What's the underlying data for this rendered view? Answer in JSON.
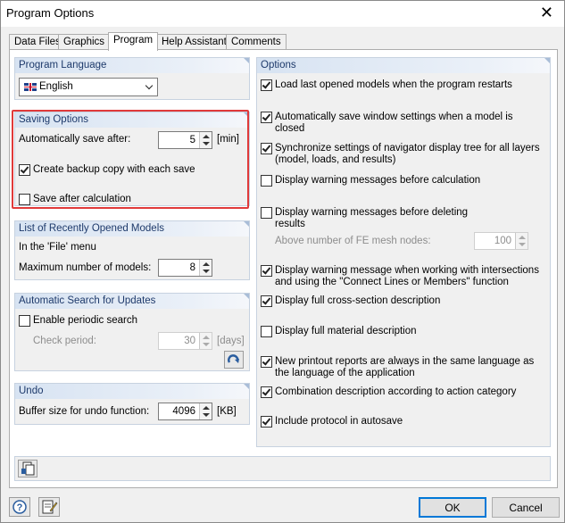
{
  "window": {
    "title": "Program Options",
    "close_glyph": "✕"
  },
  "tabs": [
    {
      "label": "Data Files",
      "active": false
    },
    {
      "label": "Graphics",
      "active": false
    },
    {
      "label": "Program",
      "active": true
    },
    {
      "label": "Help Assistant",
      "active": false
    },
    {
      "label": "Comments",
      "active": false
    }
  ],
  "program_language": {
    "title": "Program Language",
    "selected": "English",
    "flag_icon": "uk-flag-icon"
  },
  "saving_options": {
    "title": "Saving Options",
    "autosave_label": "Automatically save after:",
    "autosave_value": "5",
    "autosave_unit": "[min]",
    "backup_label": "Create backup copy with each save",
    "backup_checked": true,
    "save_after_calc_label": "Save after calculation",
    "save_after_calc_checked": false
  },
  "recent_models": {
    "title": "List of Recently Opened Models",
    "in_file_menu": "In the 'File' menu",
    "max_label": "Maximum number of models:",
    "max_value": "8"
  },
  "auto_update": {
    "title": "Automatic Search for Updates",
    "periodic_label": "Enable periodic search",
    "periodic_checked": false,
    "check_period_label": "Check period:",
    "check_period_value": "30",
    "check_period_unit": "[days]",
    "refresh_icon": "refresh-icon"
  },
  "undo": {
    "title": "Undo",
    "buffer_label": "Buffer size for undo function:",
    "buffer_value": "4096",
    "buffer_unit": "[KB]"
  },
  "options": {
    "title": "Options",
    "items": [
      {
        "line1": "Load last opened models when the program restarts",
        "line2": "",
        "checked": true
      },
      {
        "line1": "Automatically save window settings when a model is",
        "line2": "closed",
        "checked": true
      },
      {
        "line1": "Synchronize settings of navigator display tree for all layers",
        "line2": "(model, loads, and results)",
        "checked": true
      },
      {
        "line1": "Display warning messages before calculation",
        "line2": "",
        "checked": false
      },
      {
        "line1": "Display warning messages before deleting",
        "line2": "results",
        "checked": false
      },
      {
        "line1": "Display warning message when working with intersections",
        "line2": "and using the \"Connect Lines or Members\" function",
        "checked": true
      },
      {
        "line1": "Display full cross-section description",
        "line2": "",
        "checked": true
      },
      {
        "line1": "Display full material description",
        "line2": "",
        "checked": false
      },
      {
        "line1": "New printout reports are always in the same language as",
        "line2": "the language of the application",
        "checked": true
      },
      {
        "line1": "Combination description according to action category",
        "line2": "",
        "checked": true
      },
      {
        "line1": "Include protocol in autosave",
        "line2": "",
        "checked": true
      }
    ],
    "fe_nodes_label": "Above number of FE mesh nodes:",
    "fe_nodes_value": "100"
  },
  "bottom": {
    "ok_label": "OK",
    "cancel_label": "Cancel"
  },
  "colors": {
    "highlight": "#e03a3a",
    "group_title": "#1e3a6b",
    "default_button": "#0078d7"
  }
}
